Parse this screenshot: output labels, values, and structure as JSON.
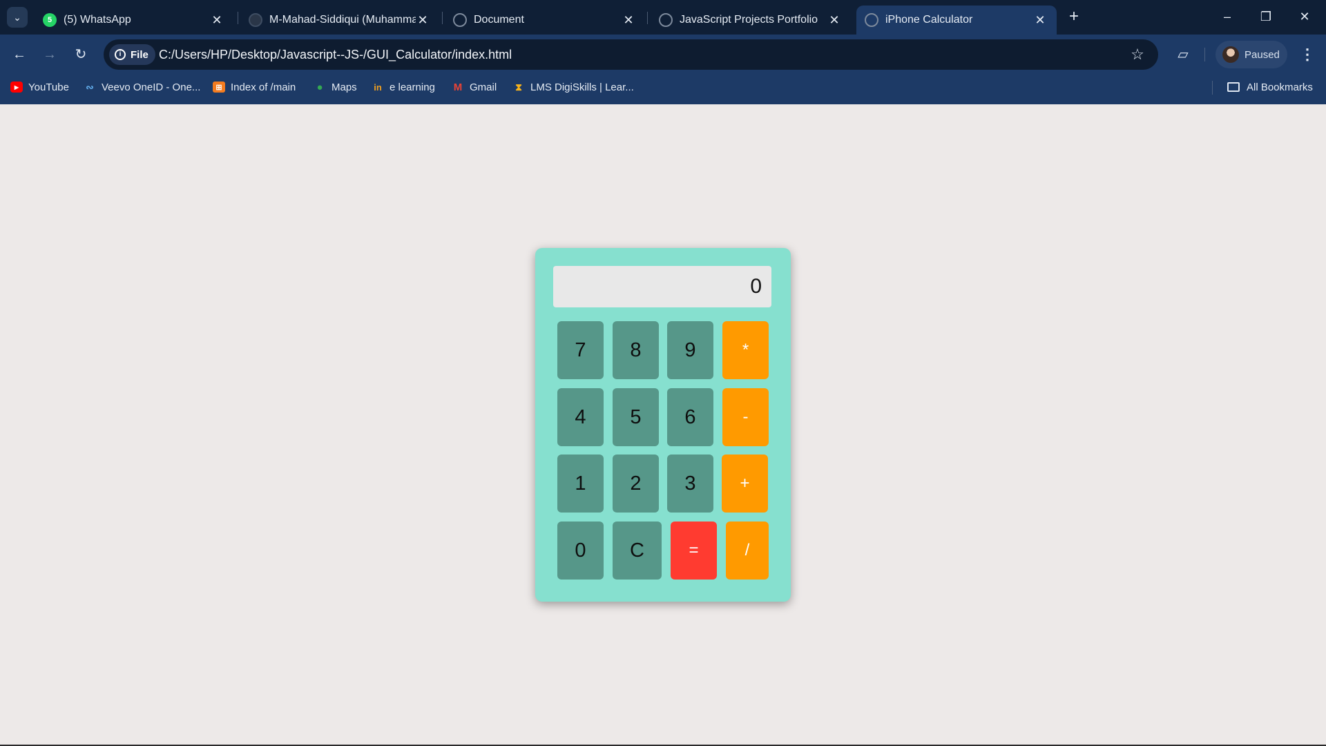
{
  "browser": {
    "tabs": [
      {
        "title": "(5) WhatsApp",
        "badge": "5",
        "icon": "whatsapp-icon"
      },
      {
        "title": "M-Mahad-Siddiqui (Muhammad",
        "icon": "github-icon"
      },
      {
        "title": "Document",
        "icon": "globe-icon"
      },
      {
        "title": "JavaScript Projects Portfolio",
        "icon": "globe-icon"
      },
      {
        "title": "iPhone Calculator",
        "icon": "globe-icon",
        "active": true
      }
    ],
    "address": {
      "chip_label": "File",
      "url": "C:/Users/HP/Desktop/Javascript--JS-/GUI_Calculator/index.html"
    },
    "profile_label": "Paused",
    "bookmarks": [
      {
        "label": "YouTube",
        "icon": "youtube-icon"
      },
      {
        "label": "Veevo OneID - One...",
        "icon": "veevo-icon"
      },
      {
        "label": "Index of /main",
        "icon": "index-icon"
      },
      {
        "label": "Maps",
        "icon": "maps-pin-icon"
      },
      {
        "label": "e learning",
        "icon": "elearning-icon"
      },
      {
        "label": "Gmail",
        "icon": "gmail-icon"
      },
      {
        "label": "LMS DigiSkills | Lear...",
        "icon": "digiskills-icon"
      }
    ],
    "all_bookmarks_label": "All Bookmarks"
  },
  "calculator": {
    "display_value": "0",
    "keys": [
      "7",
      "8",
      "9",
      "*",
      "4",
      "5",
      "6",
      "-",
      "1",
      "2",
      "3",
      "+",
      "0",
      "C",
      "=",
      "/"
    ],
    "colors": {
      "body": "#86e0cf",
      "number_key": "#569789",
      "operator_key": "#ff9a00",
      "equals_key": "#ff3b30",
      "display": "#e8e8e8"
    }
  }
}
